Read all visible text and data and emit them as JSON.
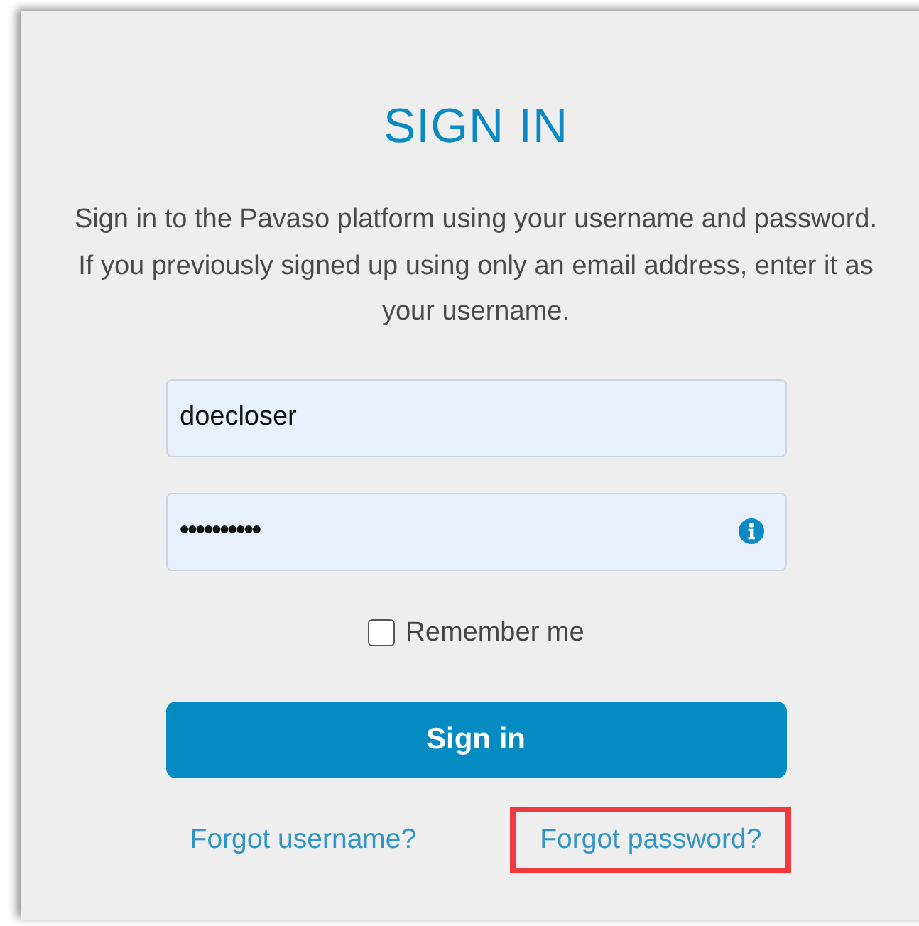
{
  "title": "SIGN IN",
  "intro": "Sign in to the Pavaso platform using your username and password. If you previously signed up using only an email address, enter it as your username.",
  "username": {
    "value": "doecloser"
  },
  "password": {
    "value": "••••••••••"
  },
  "remember": {
    "label": "Remember me",
    "checked": false
  },
  "submit": "Sign in",
  "links": [
    {
      "label": "Forgot username?",
      "highlighted": false
    },
    {
      "label": "Forgot password?",
      "highlighted": true
    }
  ]
}
